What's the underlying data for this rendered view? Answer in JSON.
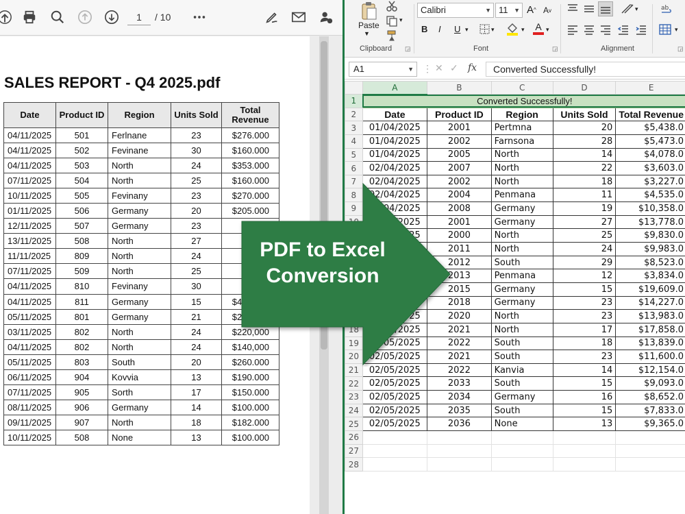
{
  "pdf_viewer": {
    "toolbar": {
      "page_current": "1",
      "page_total": "/ 10",
      "icons": [
        "upload-icon",
        "print-icon",
        "search-icon",
        "page-up-icon",
        "page-down-icon",
        "more-icon",
        "sign-icon",
        "mail-icon",
        "user-info-icon"
      ]
    },
    "document": {
      "title": "SALES REPORT - Q4 2025.pdf",
      "headers": [
        "Date",
        "Product ID",
        "Region",
        "Units Sold",
        "Total Revenue"
      ],
      "rows": [
        [
          "04/11/2025",
          "501",
          "Ferlnane",
          "23",
          "$276.000"
        ],
        [
          "04/11/2025",
          "502",
          "Fevinane",
          "30",
          "$160.000"
        ],
        [
          "04/11/2025",
          "503",
          "North",
          "24",
          "$353.000"
        ],
        [
          "07/11/2025",
          "504",
          "North",
          "25",
          "$160.000"
        ],
        [
          "10/11/2025",
          "505",
          "Fevinany",
          "23",
          "$270.000"
        ],
        [
          "01/11/2025",
          "506",
          "Germany",
          "20",
          "$205.000"
        ],
        [
          "12/11/2025",
          "507",
          "Germany",
          "23",
          "$1"
        ],
        [
          "13/11/2025",
          "508",
          "North",
          "27",
          "$2"
        ],
        [
          "11/11/2025",
          "809",
          "North",
          "24",
          "$1("
        ],
        [
          "07/11/2025",
          "509",
          "North",
          "25",
          "$1"
        ],
        [
          "04/11/2025",
          "810",
          "Fevinany",
          "30",
          "$1"
        ],
        [
          "04/11/2025",
          "811",
          "Germany",
          "15",
          "$430.000"
        ],
        [
          "05/11/2025",
          "801",
          "Germany",
          "21",
          "$230.000"
        ],
        [
          "03/11/2025",
          "802",
          "North",
          "24",
          "$220,000"
        ],
        [
          "04/11/2025",
          "802",
          "North",
          "24",
          "$140,000"
        ],
        [
          "05/11/2025",
          "803",
          "South",
          "20",
          "$260.000"
        ],
        [
          "06/11/2025",
          "904",
          "Kovvia",
          "13",
          "$190.000"
        ],
        [
          "07/11/2025",
          "905",
          "Sorth",
          "17",
          "$150.000"
        ],
        [
          "08/11/2025",
          "906",
          "Germany",
          "14",
          "$100.000"
        ],
        [
          "09/11/2025",
          "907",
          "North",
          "18",
          "$182.000"
        ],
        [
          "10/11/2025",
          "508",
          "None",
          "13",
          "$100.000"
        ]
      ]
    }
  },
  "excel": {
    "ribbon": {
      "paste_label": "Paste",
      "clipboard_label": "Clipboard",
      "font_name": "Calibri",
      "font_size": "11",
      "font_label": "Font",
      "alignment_label": "Alignment",
      "bold": "B",
      "italic": "I",
      "underline": "U",
      "grow": "A",
      "shrink": "A",
      "accent_color": "#1f7a45"
    },
    "formula_bar": {
      "name_box": "A1",
      "fx": "fx",
      "value": "Converted Successfully!"
    },
    "sheet": {
      "columns": [
        "A",
        "B",
        "C",
        "D",
        "E"
      ],
      "banner": "Converted Successfully!",
      "headers": [
        "Date",
        "Product ID",
        "Region",
        "Units Sold",
        "Total Revenue"
      ],
      "rows": [
        [
          "01/04/2025",
          "2001",
          "Pertmna",
          "20",
          "$5,438.0"
        ],
        [
          "01/04/2025",
          "2002",
          "Farnsona",
          "28",
          "$5,473.0"
        ],
        [
          "01/04/2025",
          "2005",
          "North",
          "14",
          "$4,078.0"
        ],
        [
          "02/04/2025",
          "2007",
          "North",
          "22",
          "$3,603.0"
        ],
        [
          "02/04/2025",
          "2002",
          "North",
          "18",
          "$3,227.0"
        ],
        [
          "02/04/2025",
          "2004",
          "Penmana",
          "11",
          "$4,535.0"
        ],
        [
          "02/04/2025",
          "2008",
          "Germany",
          "19",
          "$10,358.0"
        ],
        [
          "02/04/2025",
          "2001",
          "Germany",
          "27",
          "$13,778.0"
        ],
        [
          "02/04/2025",
          "2000",
          "North",
          "25",
          "$9,830.0"
        ],
        [
          "02/04/2025",
          "2011",
          "North",
          "24",
          "$9,983.0"
        ],
        [
          "02/04/2025",
          "2012",
          "South",
          "29",
          "$8,523.0"
        ],
        [
          "02/04/2025",
          "2013",
          "Penmana",
          "12",
          "$3,834.0"
        ],
        [
          "02/04/2025",
          "2015",
          "Germany",
          "15",
          "$19,609.0"
        ],
        [
          "02/04/2025",
          "2018",
          "Germany",
          "23",
          "$14,227.0"
        ],
        [
          "02/04/2025",
          "2020",
          "North",
          "23",
          "$13,983.0"
        ],
        [
          "02/05/2025",
          "2021",
          "North",
          "17",
          "$17,858.0"
        ],
        [
          "02/05/2025",
          "2022",
          "South",
          "18",
          "$13,839.0"
        ],
        [
          "02/05/2025",
          "2021",
          "South",
          "23",
          "$11,600.0"
        ],
        [
          "02/05/2025",
          "2022",
          "Kanvia",
          "14",
          "$12,154.0"
        ],
        [
          "02/05/2025",
          "2033",
          "South",
          "15",
          "$9,093.0"
        ],
        [
          "02/05/2025",
          "2034",
          "Germany",
          "16",
          "$8,652.0"
        ],
        [
          "02/05/2025",
          "2035",
          "South",
          "15",
          "$7,833.0"
        ],
        [
          "02/05/2025",
          "2036",
          "None",
          "13",
          "$9,365.0"
        ]
      ],
      "row_numbers": [
        "1",
        "2",
        "3",
        "4",
        "5",
        "6",
        "7",
        "8",
        "9",
        "10",
        "11",
        "12",
        "13",
        "14",
        "15",
        "16",
        "17",
        "18",
        "19",
        "20",
        "21",
        "22",
        "23",
        "24",
        "25",
        "26",
        "27",
        "28"
      ]
    }
  },
  "overlay": {
    "line1": "PDF to Excel",
    "line2": "Conversion",
    "color": "#2e7d45"
  }
}
